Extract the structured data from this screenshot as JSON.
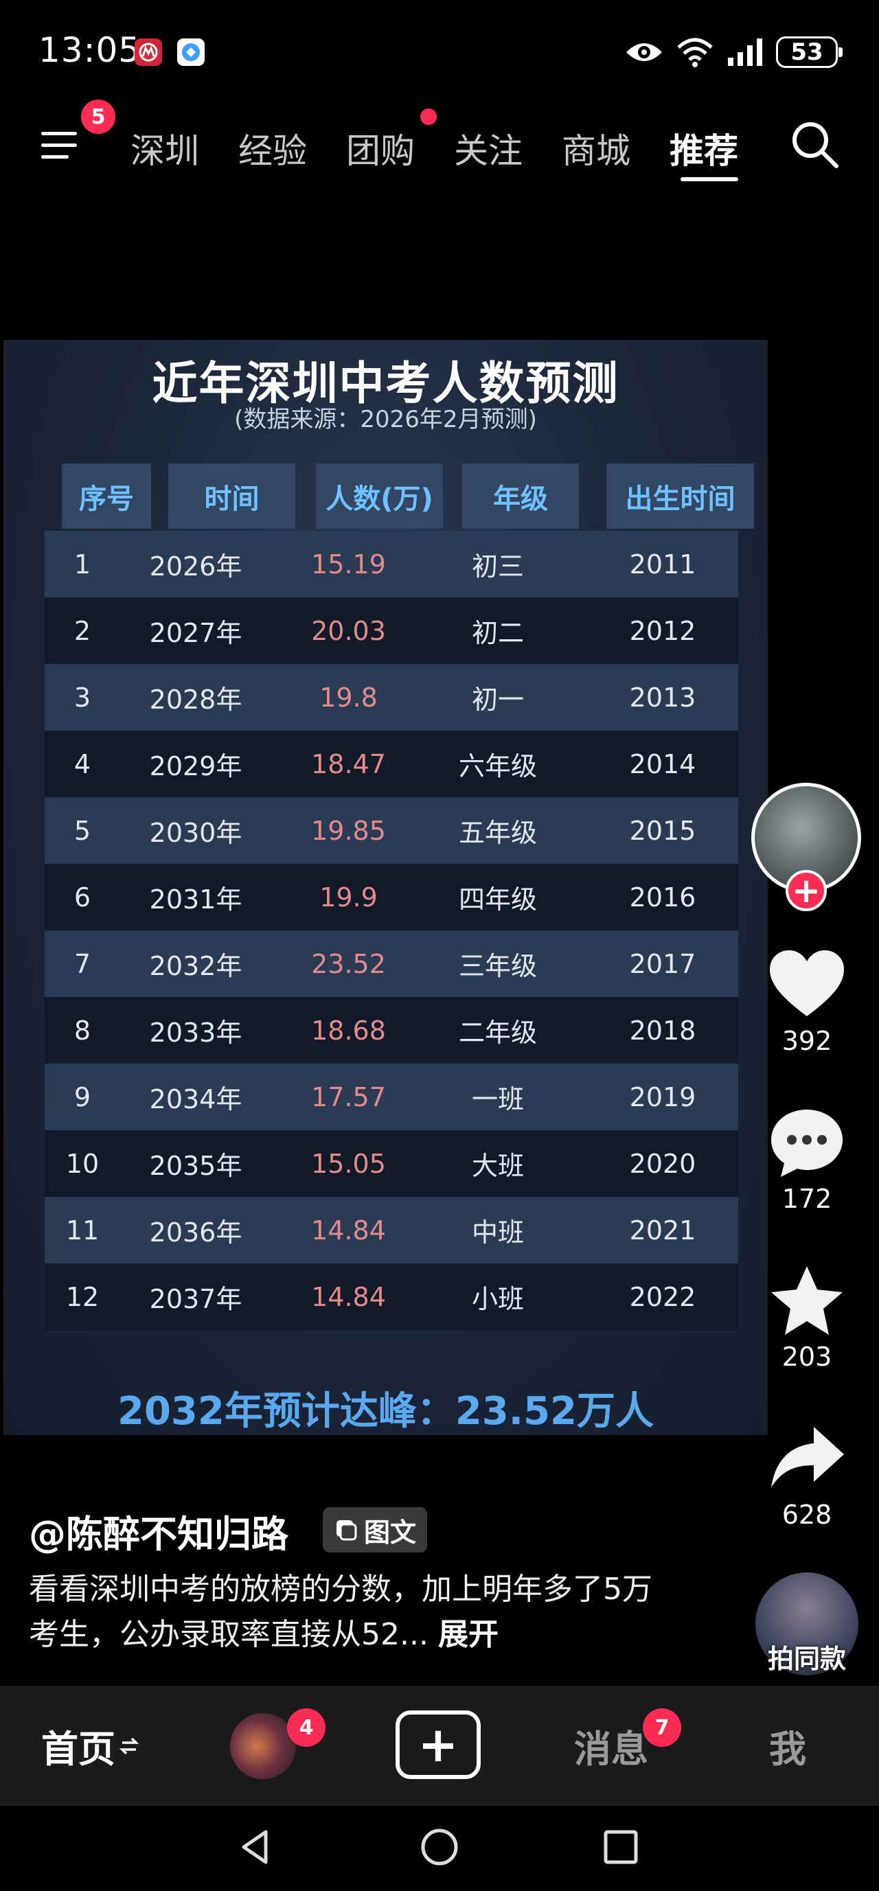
{
  "status_bar": {
    "time": "13:05",
    "battery": "53",
    "icons": [
      "bank-app-icon",
      "browser-app-icon",
      "eye-icon",
      "wifi-icon",
      "signal-icon",
      "battery-icon"
    ]
  },
  "top_nav": {
    "menu_badge": "5",
    "tabs": [
      {
        "label": "深圳"
      },
      {
        "label": "经验"
      },
      {
        "label": "团购"
      },
      {
        "label": "关注"
      },
      {
        "label": "商城"
      },
      {
        "label": "推荐"
      }
    ],
    "active_tab": "推荐"
  },
  "post_image": {
    "title": "近年深圳中考人数预测",
    "subtitle": "(数据来源：2026年2月预测)",
    "columns": [
      "序号",
      "时间",
      "人数(万)",
      "年级",
      "出生时间"
    ],
    "rows": [
      [
        "1",
        "2026年",
        "15.19",
        "初三",
        "2011"
      ],
      [
        "2",
        "2027年",
        "20.03",
        "初二",
        "2012"
      ],
      [
        "3",
        "2028年",
        "19.8",
        "初一",
        "2013"
      ],
      [
        "4",
        "2029年",
        "18.47",
        "六年级",
        "2014"
      ],
      [
        "5",
        "2030年",
        "19.85",
        "五年级",
        "2015"
      ],
      [
        "6",
        "2031年",
        "19.9",
        "四年级",
        "2016"
      ],
      [
        "7",
        "2032年",
        "23.52",
        "三年级",
        "2017"
      ],
      [
        "8",
        "2033年",
        "18.68",
        "二年级",
        "2018"
      ],
      [
        "9",
        "2034年",
        "17.57",
        "一班",
        "2019"
      ],
      [
        "10",
        "2035年",
        "15.05",
        "大班",
        "2020"
      ],
      [
        "11",
        "2036年",
        "14.84",
        "中班",
        "2021"
      ],
      [
        "12",
        "2037年",
        "14.84",
        "小班",
        "2022"
      ]
    ],
    "footer": "2032年预计达峰：23.52万人"
  },
  "actions": {
    "follow": "+",
    "likes": "392",
    "comments": "172",
    "favorites": "203",
    "shares": "628"
  },
  "caption": {
    "author": "@陈醉不知归路",
    "tag": "图文",
    "text": "看看深圳中考的放榜的分数，加上明年多了5万考生，公办录取率直接从52...",
    "expand": "展开",
    "same_style": "拍同款"
  },
  "bottom_nav": {
    "home": "首页",
    "friends_badge": "4",
    "add": "+",
    "messages": "消息",
    "messages_badge": "7",
    "me": "我"
  }
}
